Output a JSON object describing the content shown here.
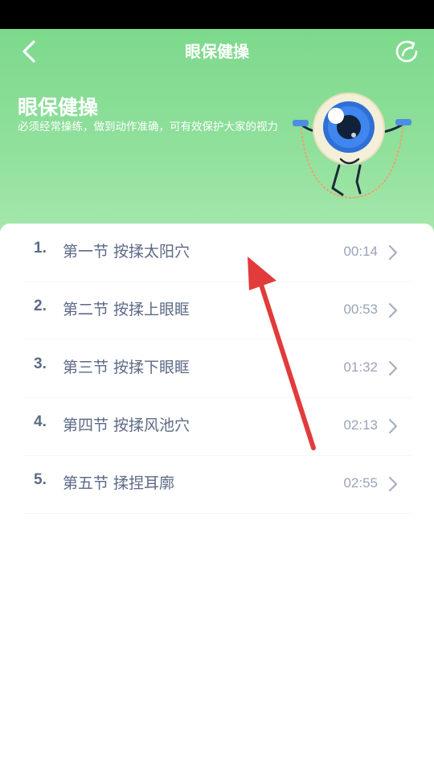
{
  "nav": {
    "title": "眼保健操",
    "back_icon": "chevron-left-icon",
    "share_icon": "share-refresh-icon"
  },
  "hero": {
    "title": "眼保健操",
    "description": "必须经常操练，做到动作准确，可有效保护大家的视力",
    "mascot": "eyeball-mascot-jumping-rope"
  },
  "sections": [
    {
      "num": "1.",
      "title": "第一节 按揉太阳穴",
      "time": "00:14"
    },
    {
      "num": "2.",
      "title": "第二节 按揉上眼眶",
      "time": "00:53"
    },
    {
      "num": "3.",
      "title": "第三节 按揉下眼眶",
      "time": "01:32"
    },
    {
      "num": "4.",
      "title": "第四节 按揉风池穴",
      "time": "02:13"
    },
    {
      "num": "5.",
      "title": "第五节 揉捏耳廓",
      "time": "02:55"
    }
  ],
  "colors": {
    "header_green": "#7dd98c",
    "text_primary": "#5c6a86",
    "text_secondary": "#9aa4b6",
    "annotation_arrow": "#e23b3b"
  }
}
